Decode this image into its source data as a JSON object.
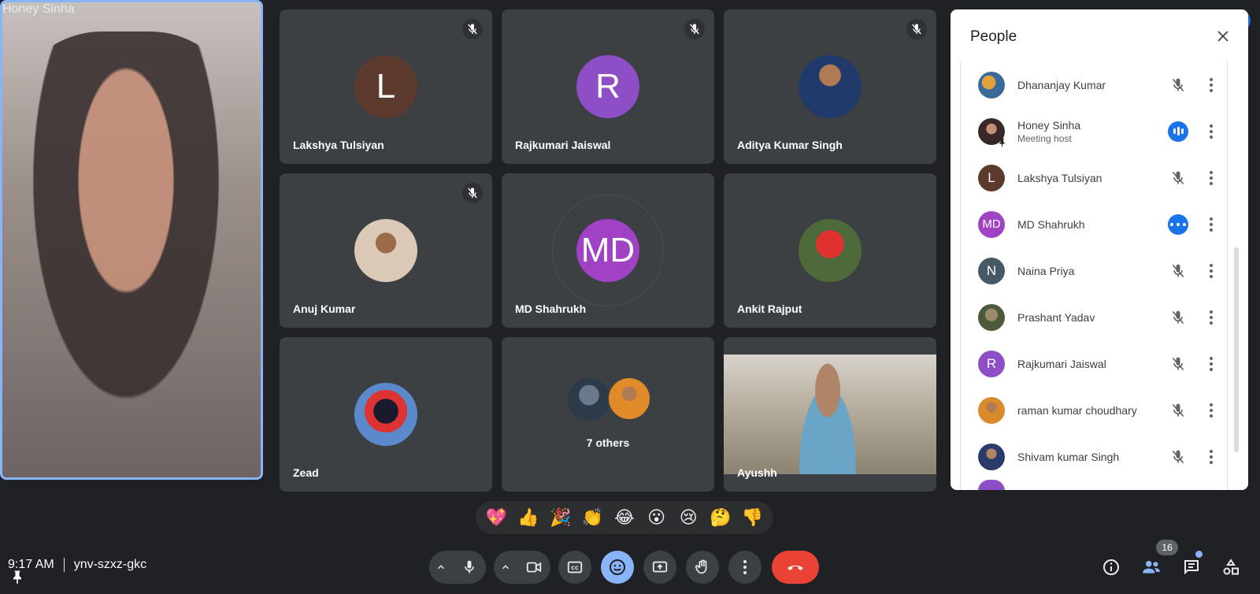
{
  "tiles": {
    "pinned": {
      "name": "Honey Sinha"
    },
    "lakshya": {
      "name": "Lakshya Tulsiyan",
      "initial": "L"
    },
    "rajkumari": {
      "name": "Rajkumari Jaiswal",
      "initial": "R"
    },
    "aditya": {
      "name": "Aditya Kumar Singh"
    },
    "anuj": {
      "name": "Anuj Kumar"
    },
    "md": {
      "name": "MD Shahrukh",
      "initial": "MD"
    },
    "ankit": {
      "name": "Ankit Rajput"
    },
    "zead": {
      "name": "Zead"
    },
    "others": {
      "label": "7 others"
    },
    "ayushh": {
      "name": "Ayushh"
    }
  },
  "people_panel": {
    "title": "People",
    "people": [
      {
        "name": "Dhananjay Kumar",
        "sub": "",
        "initial": "",
        "status": "muted"
      },
      {
        "name": "Honey Sinha",
        "sub": "Meeting host",
        "initial": "",
        "status": "speaking"
      },
      {
        "name": "Lakshya Tulsiyan",
        "sub": "",
        "initial": "L",
        "status": "muted"
      },
      {
        "name": "MD Shahrukh",
        "sub": "",
        "initial": "MD",
        "status": "more"
      },
      {
        "name": "Naina Priya",
        "sub": "",
        "initial": "N",
        "status": "muted"
      },
      {
        "name": "Prashant Yadav",
        "sub": "",
        "initial": "",
        "status": "muted"
      },
      {
        "name": "Rajkumari Jaiswal",
        "sub": "",
        "initial": "R",
        "status": "muted"
      },
      {
        "name": "raman kumar choudhary",
        "sub": "",
        "initial": "",
        "status": "muted"
      },
      {
        "name": "Shivam kumar Singh",
        "sub": "",
        "initial": "",
        "status": "muted"
      }
    ]
  },
  "reactions": [
    "💖",
    "👍",
    "🎉",
    "👏",
    "😂",
    "😮",
    "😢",
    "🤔",
    "👎"
  ],
  "meeting": {
    "time": "9:17 AM",
    "code": "ynv-szxz-gkc"
  },
  "participant_count": "16",
  "colors": {
    "accent": "#1a73e8",
    "end_call": "#ea4335",
    "avatar_l": "#5d3a2e",
    "avatar_r": "#8e4ec6",
    "avatar_md": "#a142c4",
    "avatar_n": "#455a64"
  }
}
